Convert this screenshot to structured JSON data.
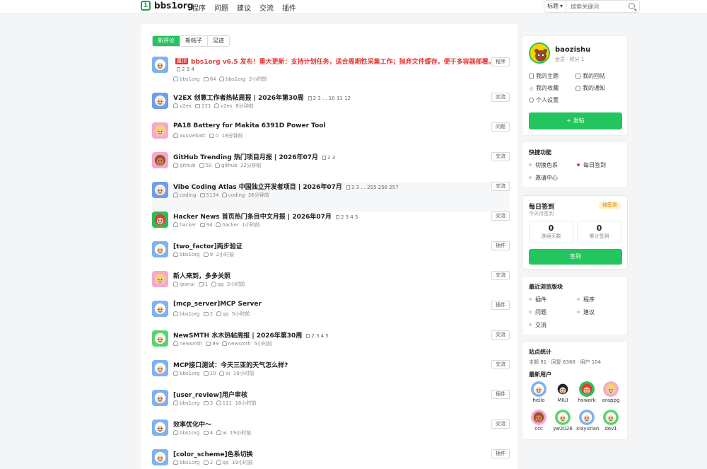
{
  "brand": {
    "name": "bbs1org",
    "logo_glyph": "1"
  },
  "nav": [
    "程序",
    "问题",
    "建议",
    "交流",
    "插件"
  ],
  "search": {
    "select_label": "标题",
    "placeholder": "搜索关键词"
  },
  "tabs": [
    {
      "label": "新评论",
      "active": true
    },
    {
      "label": "新帖子",
      "active": false
    },
    {
      "label": "足迹",
      "active": false
    }
  ],
  "topics": [
    {
      "pin": "置顶",
      "title": "bbs1org v6.5 发布！重大更新：支持计划任务，适合周期性采集工作；抛弃文件缓存，便于多容器部署。",
      "pages": "2 3 4",
      "author": "bbs1org",
      "replies": "64",
      "last": "bbs1org",
      "time": "2小时前",
      "tag": "程序",
      "avatar": "sheep"
    },
    {
      "title": "V2EX 创意工作者热帖周报 | 2026年第30周",
      "pages": "2 3 ... 10 11 12",
      "author": "v2ex",
      "replies": "221",
      "last": "v2ex",
      "time": "8分钟前",
      "tag": "交流",
      "avatar": "blue"
    },
    {
      "title": "PA18 Battery for Makita 6391D Power Tool",
      "pages": "",
      "author": "aussiebatt",
      "replies": "0",
      "last": "",
      "time": "18分钟前",
      "tag": "问题",
      "avatar": "pink"
    },
    {
      "title": "GitHub Trending 热门项目月报 | 2026年07月",
      "pages": "2 3",
      "author": "github",
      "replies": "50",
      "last": "github",
      "time": "22分钟前",
      "tag": "交流",
      "avatar": "bear"
    },
    {
      "title": "Vibe Coding Atlas 中国独立开发者项目 | 2026年07月",
      "pages": "2 3 ... 255 256 257",
      "author": "coding",
      "replies": "5134",
      "last": "coding",
      "time": "36分钟前",
      "tag": "交流",
      "avatar": "blue"
    },
    {
      "title": "Hacker News 首页热门条目中文月报 | 2026年07月",
      "pages": "2 3 4 5",
      "author": "hacker",
      "replies": "94",
      "last": "hacker",
      "time": "1小时前",
      "tag": "交流",
      "avatar": "red"
    },
    {
      "title": "[two_factor]两步验证",
      "pages": "",
      "author": "bbs1org",
      "replies": "9",
      "last": "",
      "time": "2小时前",
      "tag": "插件",
      "avatar": "sheep"
    },
    {
      "title": "新人来到，多多关照",
      "pages": "",
      "author": "iponui",
      "replies": "1",
      "last": "qq",
      "time": "2小时前",
      "tag": "交流",
      "avatar": "yellow"
    },
    {
      "title": "[mcp_server]MCP Server",
      "pages": "",
      "author": "bbs1org",
      "replies": "2",
      "last": "qq",
      "time": "5小时前",
      "tag": "插件",
      "avatar": "sheep"
    },
    {
      "title": "NewSMTH 水木热帖周报 | 2026年第30周",
      "pages": "2 3 4 5",
      "author": "newsmth",
      "replies": "89",
      "last": "newsmth",
      "time": "5小时前",
      "tag": "交流",
      "avatar": "green"
    },
    {
      "title": "MCP接口测试：今天三亚的天气怎么样?",
      "pages": "",
      "author": "bbs1org",
      "replies": "10",
      "last": "ai",
      "time": "18小时前",
      "tag": "交流",
      "avatar": "sheep"
    },
    {
      "title": "[user_review]用户审核",
      "pages": "",
      "author": "bbs1org",
      "replies": "3",
      "last": "111",
      "time": "18小时前",
      "tag": "插件",
      "avatar": "sheep"
    },
    {
      "title": "效率优化中～",
      "pages": "",
      "author": "bbs1org",
      "replies": "4",
      "last": "ai",
      "time": "19小时前",
      "tag": "交流",
      "avatar": "sheep"
    },
    {
      "title": "[color_scheme]色系切换",
      "pages": "",
      "author": "bbs1org",
      "replies": "2",
      "last": "qq",
      "time": "19小时前",
      "tag": "插件",
      "avatar": "sheep"
    }
  ],
  "user": {
    "name": "baozishu",
    "sub": "会员 · 积分 1",
    "links": [
      "我的主题",
      "我的回帖",
      "我的收藏",
      "我的通知",
      "个人设置"
    ],
    "post_button": "+ 发帖"
  },
  "quick": {
    "title": "快捷功能",
    "items": [
      "切换色系",
      "每日签到",
      "邀请中心"
    ]
  },
  "checkin": {
    "title": "每日签到",
    "sub": "今天待签到",
    "badge": "待签到",
    "streak_value": "0",
    "streak_label": "连续天数",
    "total_value": "0",
    "total_label": "累计签到",
    "button": "签到"
  },
  "recent": {
    "title": "最近浏览版块",
    "items": [
      "插件",
      "程序",
      "问题",
      "建议",
      "交流"
    ]
  },
  "site_stats": {
    "title": "站点统计",
    "line": "主题 91 · 回复 6368 · 用户 104",
    "new_users_title": "最新用户",
    "new_users": [
      {
        "name": "hello",
        "avatar": "sheep"
      },
      {
        "name": "MIUI",
        "avatar": "dark"
      },
      {
        "name": "hxwork",
        "avatar": "red"
      },
      {
        "name": "orappg",
        "avatar": "pink"
      },
      {
        "name": "ccc",
        "avatar": "bear"
      },
      {
        "name": "yw2026",
        "avatar": "green"
      },
      {
        "name": "xiayutian",
        "avatar": "sheep"
      },
      {
        "name": "dev1",
        "avatar": "green"
      }
    ]
  },
  "colors": {
    "accent": "#22c55e",
    "danger": "#e53935",
    "pending_bg": "#fef3c7",
    "pending_fg": "#d97706"
  }
}
